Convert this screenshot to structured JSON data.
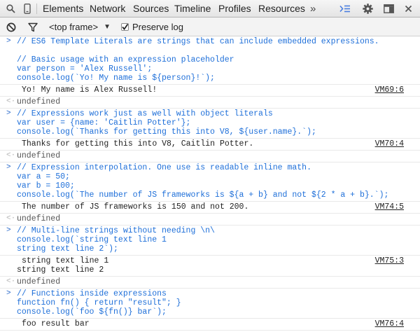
{
  "toolbar": {
    "tabs": [
      {
        "label": "Elements"
      },
      {
        "label": "Network"
      },
      {
        "label": "Sources"
      },
      {
        "label": "Timeline"
      },
      {
        "label": "Profiles"
      },
      {
        "label": "Resources"
      }
    ],
    "more_glyph": "»",
    "accent": "#4a7ee0"
  },
  "filterbar": {
    "frame_select": "<top frame>",
    "frame_select_arrow": "▼",
    "preserve_log_label": "Preserve log",
    "preserve_log_checked": true
  },
  "console": {
    "prompt_glyph": ">",
    "result_glyph": "<·",
    "entries": [
      {
        "input": [
          "// ES6 Template Literals are strings that can include embedded expressions.",
          "",
          "// Basic usage with an expression placeholder",
          "var person = 'Alex Russell';",
          "console.log(`Yo! My name is ${person}!`);"
        ],
        "output": [
          "Yo! My name is Alex Russell!"
        ],
        "source": "VM69:6",
        "result": "undefined"
      },
      {
        "input": [
          "// Expressions work just as well with object literals",
          "var user = {name: 'Caitlin Potter'};",
          "console.log(`Thanks for getting this into V8, ${user.name}.`);"
        ],
        "output": [
          "Thanks for getting this into V8, Caitlin Potter."
        ],
        "source": "VM70:4",
        "result": "undefined"
      },
      {
        "input": [
          "// Expression interpolation. One use is readable inline math.",
          "var a = 50;",
          "var b = 100;",
          "console.log(`The number of JS frameworks is ${a + b} and not ${2 * a + b}.`);"
        ],
        "output": [
          "The number of JS frameworks is 150 and not 200."
        ],
        "source": "VM74:5",
        "result": "undefined"
      },
      {
        "input": [
          "// Multi-line strings without needing \\n\\",
          "console.log(`string text line 1",
          "string text line 2`);"
        ],
        "output": [
          "string text line 1",
          "string text line 2"
        ],
        "source": "VM75:3",
        "result": "undefined"
      },
      {
        "input": [
          "// Functions inside expressions",
          "function fn() { return \"result\"; }",
          "console.log(`foo ${fn()} bar`);"
        ],
        "output": [
          "foo result bar"
        ],
        "source": "VM76:4"
      }
    ]
  }
}
